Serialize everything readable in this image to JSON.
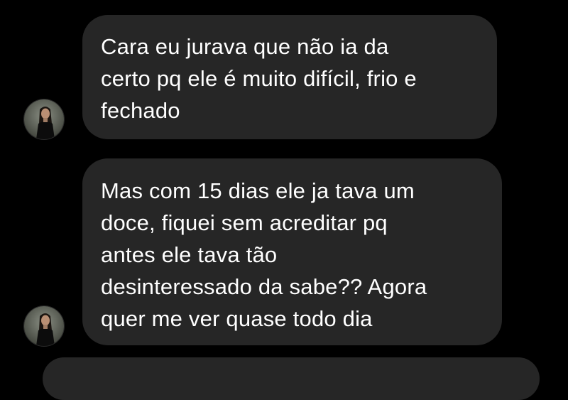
{
  "conversation": {
    "messages": [
      {
        "sender": "other",
        "lines": [
          "Cara eu jurava que não ia da",
          "certo pq ele é muito difícil, frio e",
          "fechado"
        ]
      },
      {
        "sender": "other",
        "lines": [
          "Mas com 15 dias ele ja tava um",
          "doce, fiquei sem acreditar pq",
          "antes ele tava tão",
          "desinteressado da sabe?? Agora",
          "quer me ver quase todo dia"
        ]
      }
    ]
  },
  "colors": {
    "background": "#000000",
    "bubble": "#262626",
    "text": "#ffffff"
  }
}
